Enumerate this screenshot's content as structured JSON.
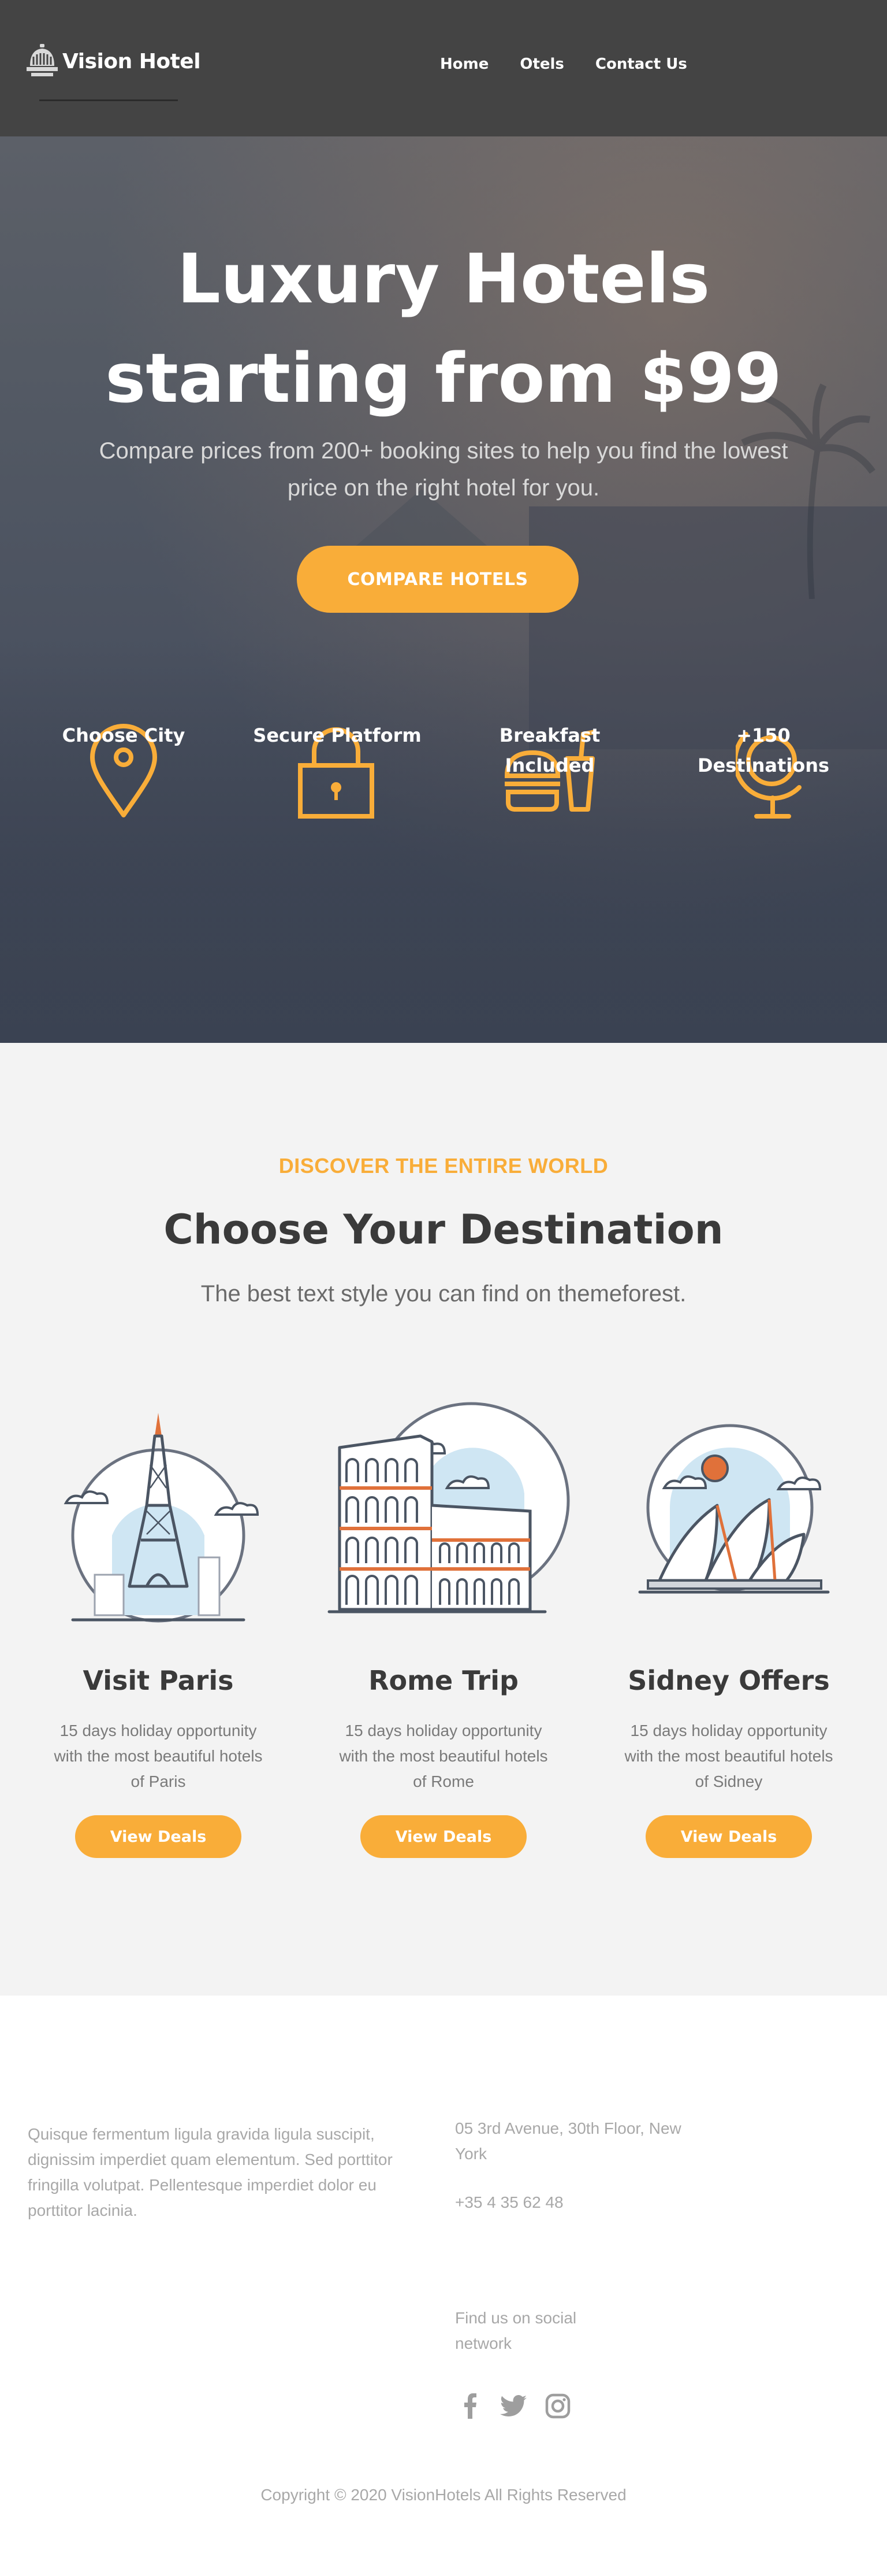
{
  "brand": {
    "name": "Vision Hotel",
    "logo_icon": "hotel-bell-icon"
  },
  "nav": {
    "items": [
      "Home",
      "Otels",
      "Contact Us"
    ]
  },
  "hero": {
    "title_line1": "Luxury Hotels",
    "title_line2": "starting from $99",
    "subtitle": "Compare prices from 200+ booking sites to help you find the lowest price on the right hotel for you.",
    "cta_label": "COMPARE HOTELS",
    "features": [
      {
        "icon": "map-pin-icon",
        "label_line1": "Choose City",
        "label_line2": ""
      },
      {
        "icon": "padlock-icon",
        "label_line1": "Secure Platform",
        "label_line2": ""
      },
      {
        "icon": "burger-drink-icon",
        "label_line1": "Breakfast",
        "label_line2": "Included"
      },
      {
        "icon": "globe-icon",
        "label_line1": "+150",
        "label_line2": "Destinations"
      }
    ]
  },
  "destinations": {
    "eyebrow": "DISCOVER THE ENTIRE WORLD",
    "title": "Choose Your Destination",
    "subtitle": "The best text style you can find on themeforest.",
    "cards": [
      {
        "illustration": "eiffel-tower-icon",
        "title": "Visit Paris",
        "desc_line1": "15 days holiday opportunity",
        "desc_line2": "with the most beautiful hotels",
        "desc_line3": "of Paris",
        "button": "View Deals"
      },
      {
        "illustration": "colosseum-icon",
        "title": "Rome Trip",
        "desc_line1": "15 days holiday opportunity",
        "desc_line2": "with the most beautiful hotels",
        "desc_line3": "of Rome",
        "button": "View Deals"
      },
      {
        "illustration": "sydney-opera-house-icon",
        "title": "Sidney Offers",
        "desc_line1": "15 days holiday opportunity",
        "desc_line2": "with the most beautiful hotels",
        "desc_line3": "of Sidney",
        "button": "View Deals"
      }
    ]
  },
  "footer": {
    "about_lines": [
      "Quisque fermentum ligula gravida ligula suscipit,",
      "dignissim imperdiet quam elementum. Sed porttitor",
      "fringilla volutpat. Pellentesque imperdiet dolor eu",
      "porttitor lacinia."
    ],
    "address_lines": [
      "05 3rd Avenue, 30th Floor, New",
      "York"
    ],
    "phone": "+35 4 35 62 48",
    "social_lines": [
      "Find us on social",
      "network"
    ],
    "social_icons": [
      "facebook-icon",
      "twitter-icon",
      "instagram-icon"
    ],
    "copyright": "Copyright © 2020 VisionHotels All Rights Reserved"
  },
  "colors": {
    "accent": "#f9ad39",
    "header_bg": "#444444",
    "section_bg": "#f3f3f3",
    "text_dark": "#3a3a3a",
    "text_muted": "#a8a8a8"
  }
}
